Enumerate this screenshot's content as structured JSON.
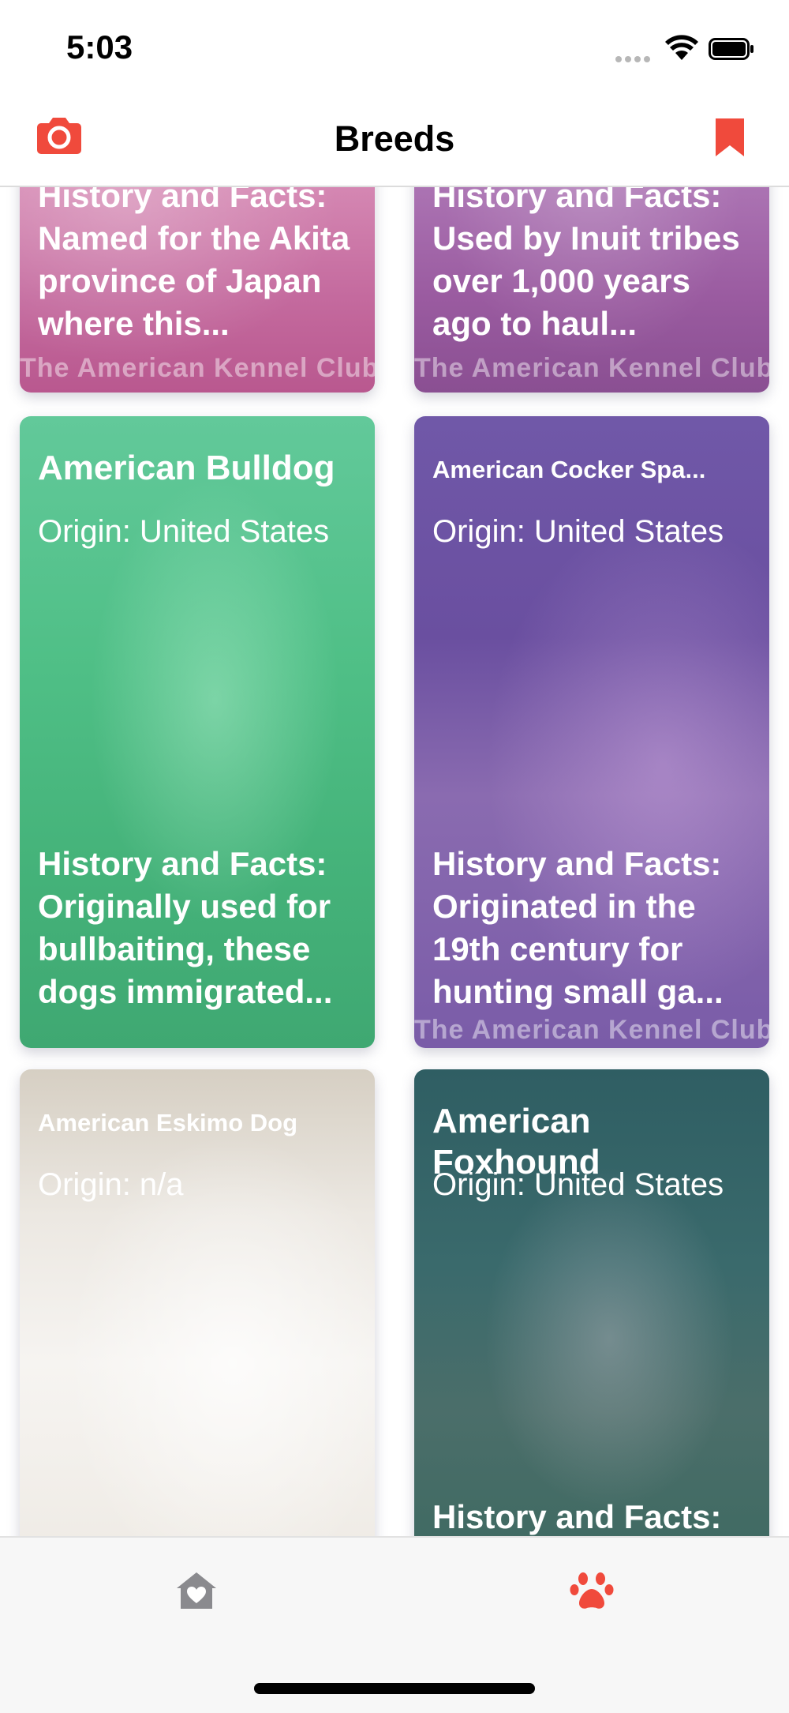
{
  "status_bar": {
    "time": "5:03"
  },
  "nav": {
    "title": "Breeds",
    "left_icon": "camera-icon",
    "right_icon": "bookmark-icon"
  },
  "accent_color": "#f04a3c",
  "cards": [
    {
      "facts": "History and Facts: Named for the Akita province of Japan where this...",
      "watermark": "The American Kennel Club",
      "tint": "#c8619a"
    },
    {
      "facts": "History and Facts: Used by Inuit tribes over 1,000 years ago to haul...",
      "watermark": "The American Kennel Club",
      "tint": "#9a5ba0"
    },
    {
      "name": "American Bulldog",
      "origin": "Origin: United States",
      "facts": "History and Facts: Originally used for bullbaiting, these dogs immigrated...",
      "tint": "#4fbf86"
    },
    {
      "name": "American Cocker Spa...",
      "origin": "Origin: United States",
      "facts": "History and Facts: Originated in the 19th century for hunting small ga...",
      "watermark": "The American Kennel Club",
      "tint": "#6a4fa0"
    },
    {
      "name": "American Eskimo Dog",
      "origin": "Origin: n/a",
      "tint": "#e8e2d8"
    },
    {
      "name": "American Foxhound",
      "origin": "Origin: United States",
      "facts": "History and Facts:",
      "tint": "#2f5e63"
    }
  ],
  "tab_bar": {
    "items": [
      {
        "icon": "home-heart-icon"
      },
      {
        "icon": "paw-icon"
      }
    ]
  }
}
